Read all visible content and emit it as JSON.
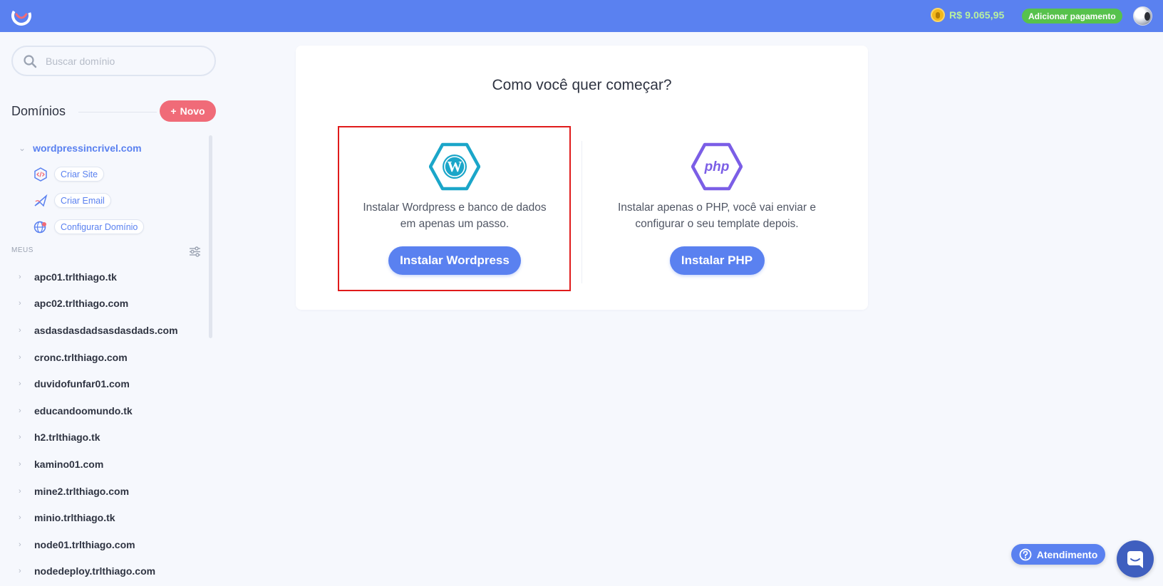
{
  "header": {
    "balance": "R$ 9.065,95",
    "add_payment_label": "Adicionar pagamento",
    "coin_icon": "coin-icon",
    "avatar_icon": "avatar"
  },
  "sidebar": {
    "search_placeholder": "Buscar domínio",
    "domains_title": "Domínios",
    "new_button_label": "Novo",
    "selected_domain": {
      "name": "wordpressincrivel.com",
      "actions": [
        {
          "label": "Criar Site",
          "icon": "code-icon"
        },
        {
          "label": "Criar Email",
          "icon": "paper-plane-icon"
        },
        {
          "label": "Configurar Domínio",
          "icon": "globe-pin-icon"
        }
      ]
    },
    "section_label": "MEUS",
    "domains": [
      "apc01.trlthiago.tk",
      "apc02.trlthiago.com",
      "asdasdasdadsasdasdads.com",
      "cronc.trlthiago.com",
      "duvidofunfar01.com",
      "educandoomundo.tk",
      "h2.trlthiago.tk",
      "kamino01.com",
      "mine2.trlthiago.com",
      "minio.trlthiago.tk",
      "node01.trlthiago.com",
      "nodedeploy.trlthiago.com"
    ]
  },
  "main": {
    "title": "Como você quer começar?",
    "wordpress": {
      "description_line1": "Instalar Wordpress e banco de dados",
      "description_line2": "em apenas um passo.",
      "button_label": "Instalar Wordpress"
    },
    "php": {
      "icon_text": "php",
      "description_line1": "Instalar apenas o PHP, você vai enviar e",
      "description_line2": "configurar o seu template depois.",
      "button_label": "Instalar PHP"
    }
  },
  "support": {
    "atendimento_label": "Atendimento"
  },
  "colors": {
    "primary": "#5a81f0",
    "success": "#57c24c",
    "danger": "#f06b78",
    "highlight": "#e01b1b",
    "wordpress": "#1ba6c9",
    "php": "#7b5ee6"
  }
}
